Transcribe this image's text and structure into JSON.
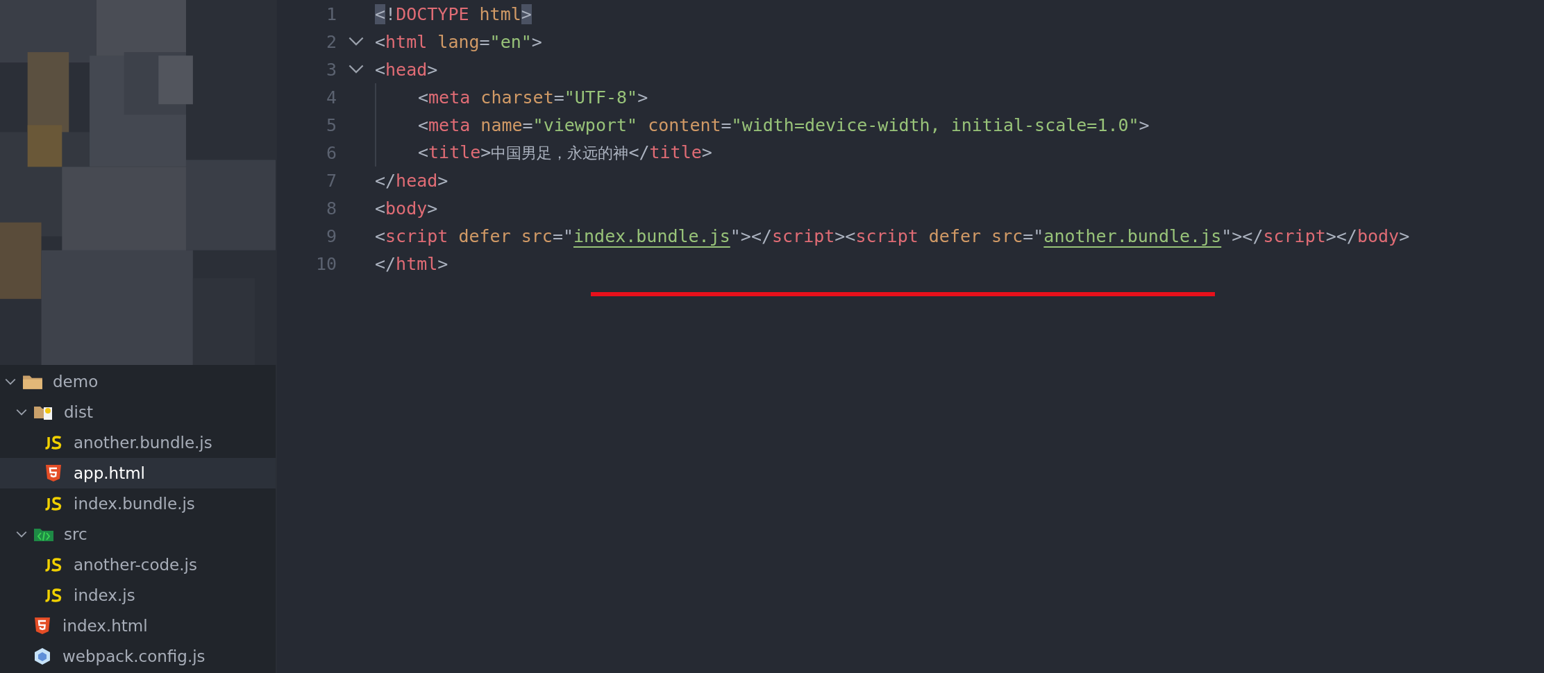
{
  "sidebar": {
    "tree": [
      {
        "label": "demo",
        "kind": "folder",
        "expanded": true,
        "selected": false,
        "children": [
          {
            "label": "dist",
            "kind": "dist-folder",
            "expanded": true,
            "selected": false,
            "children": [
              {
                "label": "another.bundle.js",
                "kind": "js",
                "selected": false
              },
              {
                "label": "app.html",
                "kind": "html",
                "selected": true
              },
              {
                "label": "index.bundle.js",
                "kind": "js",
                "selected": false
              }
            ]
          },
          {
            "label": "src",
            "kind": "src-folder",
            "expanded": true,
            "selected": false,
            "children": [
              {
                "label": "another-code.js",
                "kind": "js",
                "selected": false
              },
              {
                "label": "index.js",
                "kind": "js",
                "selected": false
              }
            ]
          },
          {
            "label": "index.html",
            "kind": "html",
            "selected": false
          },
          {
            "label": "webpack.config.js",
            "kind": "webpack",
            "selected": false
          }
        ]
      }
    ]
  },
  "editor": {
    "lines": [
      {
        "number": "1",
        "tokens": [
          {
            "kind": "match",
            "s": "<"
          },
          {
            "kind": "punct",
            "s": "!"
          },
          {
            "kind": "tag",
            "s": "DOCTYPE"
          },
          {
            "kind": "attr",
            "s": " html"
          },
          {
            "kind": "match",
            "s": ">"
          }
        ]
      },
      {
        "number": "2",
        "expanded": true,
        "tokens": [
          {
            "kind": "punct",
            "s": "<"
          },
          {
            "kind": "tag",
            "s": "html"
          },
          {
            "kind": "attr",
            "s": " lang"
          },
          {
            "kind": "punct",
            "s": "="
          },
          {
            "kind": "string",
            "s": "\"en\""
          },
          {
            "kind": "punct",
            "s": ">"
          }
        ]
      },
      {
        "number": "3",
        "expanded": true,
        "tokens": [
          {
            "kind": "punct",
            "s": "<"
          },
          {
            "kind": "tag",
            "s": "head"
          },
          {
            "kind": "punct",
            "s": ">"
          }
        ],
        "children": [
          {
            "number": "4",
            "tokens": [
              {
                "kind": "punct",
                "s": "<"
              },
              {
                "kind": "tag",
                "s": "meta"
              },
              {
                "kind": "attr",
                "s": " charset"
              },
              {
                "kind": "punct",
                "s": "="
              },
              {
                "kind": "string",
                "s": "\"UTF-8\""
              },
              {
                "kind": "punct",
                "s": ">"
              }
            ]
          },
          {
            "number": "5",
            "tokens": [
              {
                "kind": "punct",
                "s": "<"
              },
              {
                "kind": "tag",
                "s": "meta"
              },
              {
                "kind": "attr",
                "s": " name"
              },
              {
                "kind": "punct",
                "s": "="
              },
              {
                "kind": "string",
                "s": "\"viewport\""
              },
              {
                "kind": "attr",
                "s": " content"
              },
              {
                "kind": "punct",
                "s": "="
              },
              {
                "kind": "string",
                "s": "\"width=device-width, initial-scale=1.0\""
              },
              {
                "kind": "punct",
                "s": ">"
              }
            ]
          },
          {
            "number": "6",
            "tokens": [
              {
                "kind": "punct",
                "s": "<"
              },
              {
                "kind": "tag",
                "s": "title"
              },
              {
                "kind": "punct",
                "s": ">"
              },
              {
                "kind": "text",
                "s": "中国男足，永远的神"
              },
              {
                "kind": "punct",
                "s": "</"
              },
              {
                "kind": "tag",
                "s": "title"
              },
              {
                "kind": "punct",
                "s": ">"
              }
            ]
          }
        ]
      },
      {
        "number": "7",
        "tokens": [
          {
            "kind": "punct",
            "s": "</"
          },
          {
            "kind": "tag",
            "s": "head"
          },
          {
            "kind": "punct",
            "s": ">"
          }
        ]
      },
      {
        "number": "8",
        "tokens": [
          {
            "kind": "punct",
            "s": "<"
          },
          {
            "kind": "tag",
            "s": "body"
          },
          {
            "kind": "punct",
            "s": ">"
          }
        ]
      },
      {
        "number": "9",
        "tokens": [
          {
            "kind": "punct",
            "s": "<"
          },
          {
            "kind": "tag",
            "s": "script"
          },
          {
            "kind": "attr",
            "s": " defer src"
          },
          {
            "kind": "punct",
            "s": "=\""
          },
          {
            "kind": "link",
            "s": "index.bundle.js"
          },
          {
            "kind": "punct",
            "s": "\"></"
          },
          {
            "kind": "tag",
            "s": "script"
          },
          {
            "kind": "punct",
            "s": "><"
          },
          {
            "kind": "tag",
            "s": "script"
          },
          {
            "kind": "attr",
            "s": " defer src"
          },
          {
            "kind": "punct",
            "s": "=\""
          },
          {
            "kind": "link",
            "s": "another.bundle.js"
          },
          {
            "kind": "punct",
            "s": "\"></"
          },
          {
            "kind": "tag",
            "s": "script"
          },
          {
            "kind": "punct",
            "s": "></"
          },
          {
            "kind": "tag",
            "s": "body"
          },
          {
            "kind": "punct",
            "s": ">"
          }
        ]
      },
      {
        "number": "10",
        "tokens": [
          {
            "kind": "punct",
            "s": "</"
          },
          {
            "kind": "tag",
            "s": "html"
          },
          {
            "kind": "punct",
            "s": ">"
          }
        ]
      }
    ]
  }
}
